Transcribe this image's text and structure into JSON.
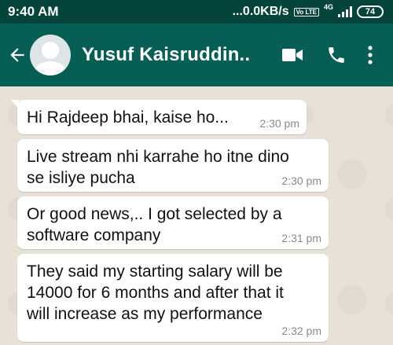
{
  "status_bar": {
    "time": "9:40 AM",
    "speed": "...0.0KB/s",
    "volte": "Vo LTE",
    "network": "4G",
    "battery": "74"
  },
  "header": {
    "contact_name": "Yusuf Kaisruddin...",
    "icons": [
      "back-arrow-icon",
      "avatar",
      "video-call-icon",
      "phone-call-icon",
      "more-options-icon"
    ]
  },
  "messages": [
    {
      "lines": [
        "Hi Rajdeep bhai, kaise ho..."
      ],
      "time": "2:30 pm"
    },
    {
      "lines": [
        "Live stream nhi karrahe ho itne dino",
        "se isliye pucha"
      ],
      "time": "2:30 pm"
    },
    {
      "lines": [
        "Or good news,.. I got selected by a",
        "software company"
      ],
      "time": "2:31 pm"
    },
    {
      "lines": [
        "They said my starting salary will be",
        "14000 for 6 months and after that it",
        "will increase as my performance"
      ],
      "time": "2:32 pm"
    }
  ],
  "colors": {
    "status_bar": "#05443b",
    "app_bar": "#075e54",
    "chat_background": "#e8e1d8",
    "bubble": "#ffffff",
    "timestamp": "#8a8a8a"
  }
}
